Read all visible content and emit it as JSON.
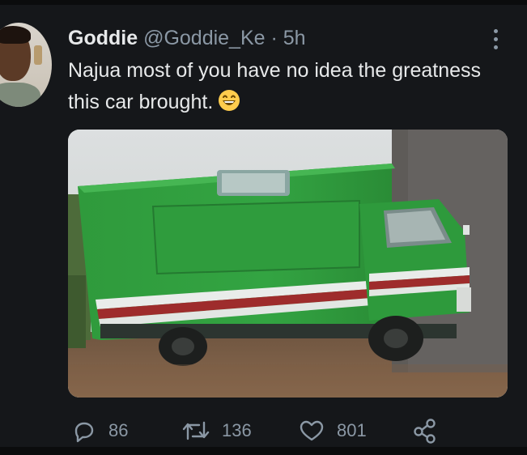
{
  "tweet": {
    "display_name": "Goddie",
    "handle": "@Goddie_Ke",
    "separator": "·",
    "time": "5h",
    "text": "Najua most of you have no idea the greatness this car brought.",
    "emoji_icon": "grinning-face-emoji"
  },
  "actions": {
    "replies": "86",
    "retweets": "136",
    "likes": "801"
  },
  "colors": {
    "background": "#15171a",
    "text": "#e7e9ea",
    "secondary": "#8b98a5"
  }
}
